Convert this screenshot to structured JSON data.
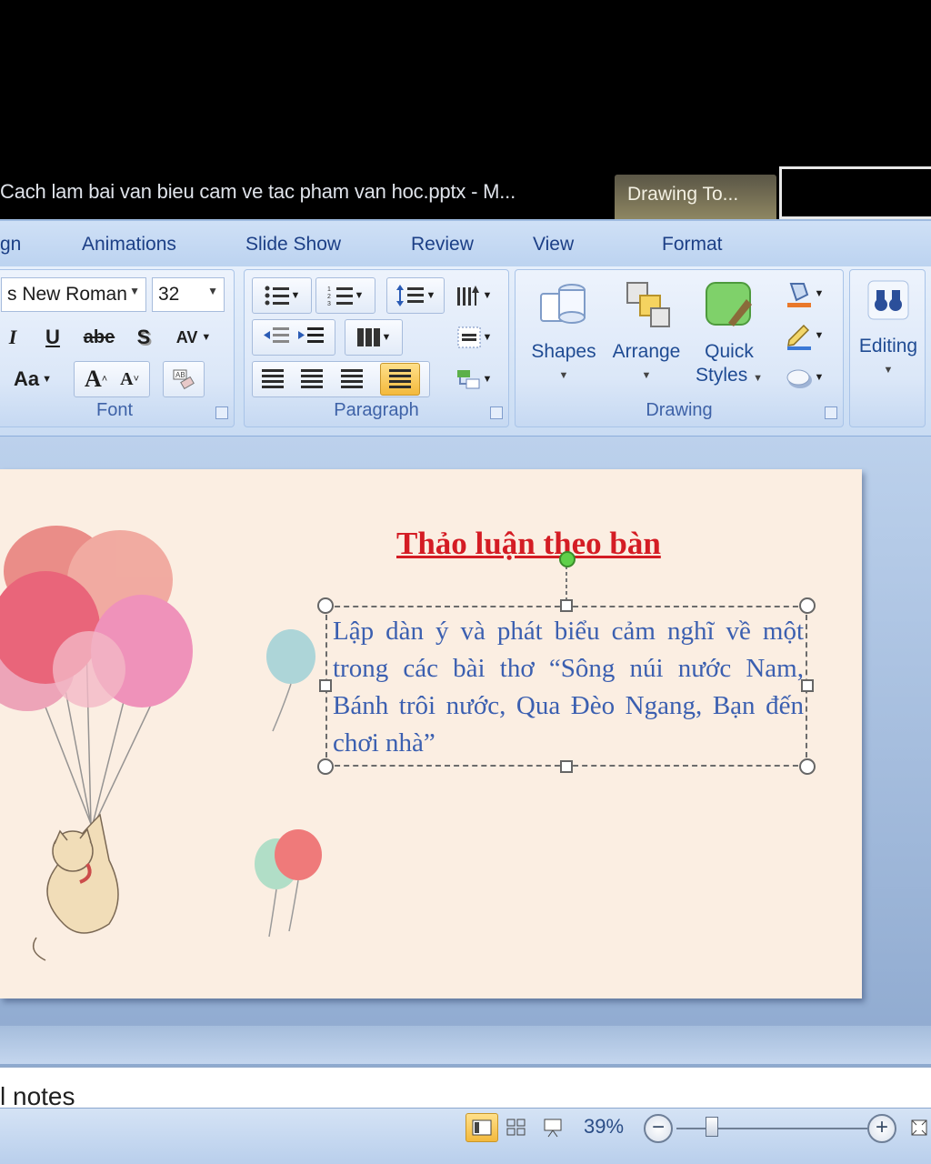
{
  "window": {
    "title": "Cach lam bai van bieu cam ve tac pham van hoc.pptx - M...",
    "context_tab": "Drawing To..."
  },
  "ribbon_tabs": [
    "gn",
    "Animations",
    "Slide Show",
    "Review",
    "View",
    "Format"
  ],
  "font_group": {
    "font_name": "s New Roman",
    "font_size": "32",
    "italic": "I",
    "underline": "U",
    "strike": "abe",
    "shadow": "S",
    "spacing": "AV",
    "change_case": "Aa",
    "grow": "A",
    "shrink": "A",
    "label": "Font"
  },
  "paragraph_group": {
    "label": "Paragraph"
  },
  "drawing_group": {
    "shapes": "Shapes",
    "arrange": "Arrange",
    "quick": "Quick",
    "styles": "Styles",
    "label": "Drawing"
  },
  "editing_group": {
    "label": "Editing"
  },
  "slide": {
    "title": "Thảo luận theo bàn",
    "body": "Lập dàn ý và phát biểu cảm nghĩ về một trong các bài thơ “Sông núi nước Nam, Bánh trôi nước, Qua Đèo Ngang, Bạn đến chơi nhà”"
  },
  "notes": {
    "placeholder": "l notes"
  },
  "status": {
    "zoom": "39%",
    "minus": "−",
    "plus": "+"
  },
  "colors": {
    "title_red": "#d41c24",
    "body_blue": "#3b5fb0",
    "slide_bg": "#fbeee2",
    "ribbon_text": "#1c3f86"
  }
}
